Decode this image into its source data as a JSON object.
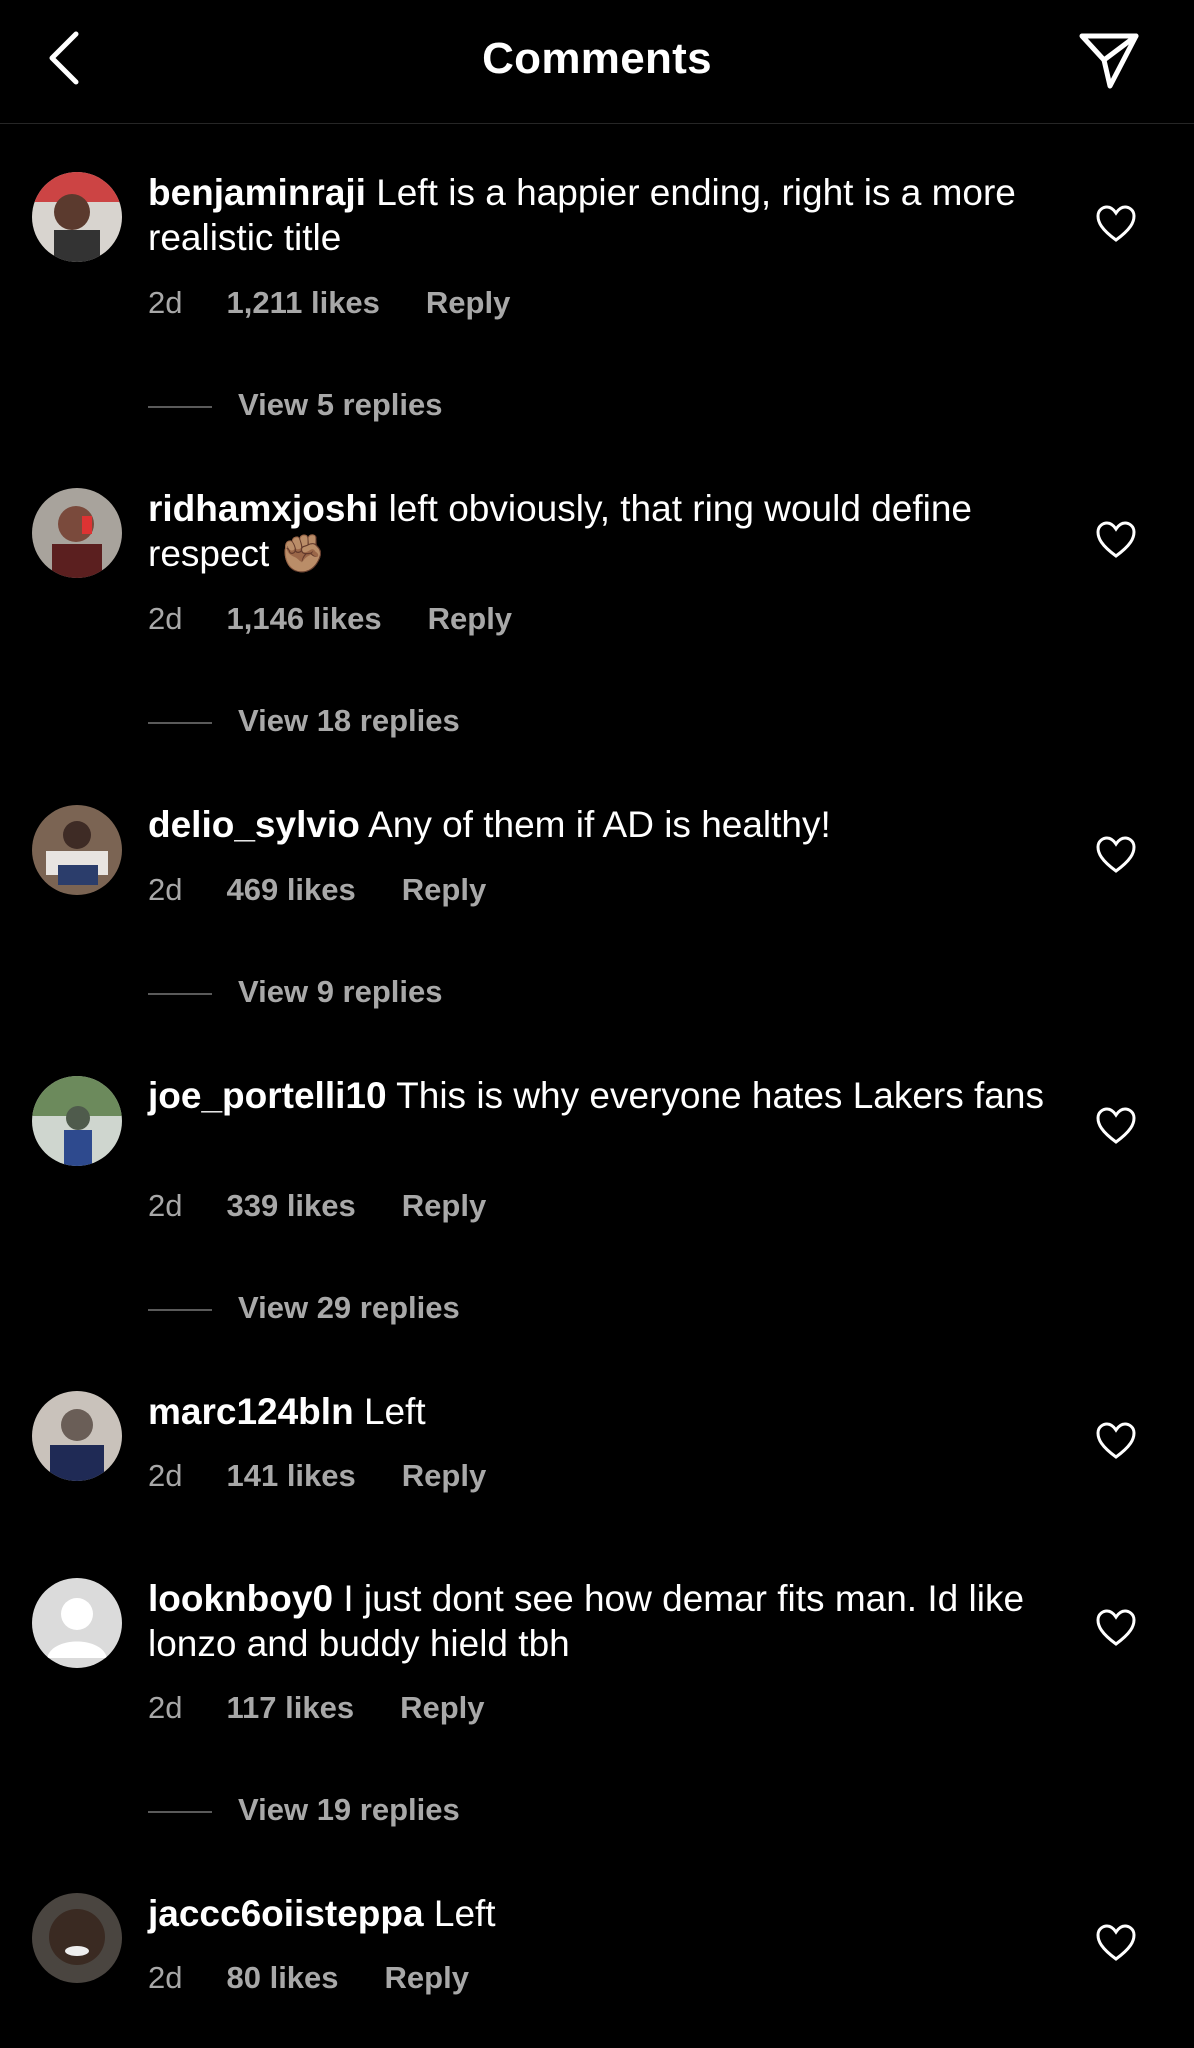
{
  "header": {
    "title": "Comments",
    "back_icon": "chevron-left-icon",
    "send_icon": "paper-plane-icon"
  },
  "comments": [
    {
      "username": "benjaminraji",
      "text": "Left is a happier ending, right is a more realistic title",
      "time": "2d",
      "likes": "1,211 likes",
      "reply": "Reply",
      "view_replies": "View 5 replies",
      "avatar_bg": "#5b3a2e"
    },
    {
      "username": "ridhamxjoshi",
      "text": "left obviously, that ring would define respect ✊🏽",
      "time": "2d",
      "likes": "1,146 likes",
      "reply": "Reply",
      "view_replies": "View 18 replies",
      "avatar_bg": "#7a4a3c"
    },
    {
      "username": "delio_sylvio",
      "text": "Any of them if AD is healthy!",
      "time": "2d",
      "likes": "469 likes",
      "reply": "Reply",
      "view_replies": "View 9 replies",
      "avatar_bg": "#3e2b25"
    },
    {
      "username": "joe_portelli10",
      "text": "This is why everyone hates Lakers fans",
      "time": "2d",
      "likes": "339 likes",
      "reply": "Reply",
      "view_replies": "View 29 replies",
      "avatar_bg": "#4f5b4c"
    },
    {
      "username": "marc124bln",
      "text": "Left",
      "time": "2d",
      "likes": "141 likes",
      "reply": "Reply",
      "view_replies": "",
      "avatar_bg": "#6a5e57"
    },
    {
      "username": "looknboy0",
      "text": "I just dont see how demar fits man. Id like lonzo and buddy hield  tbh",
      "time": "2d",
      "likes": "117 likes",
      "reply": "Reply",
      "view_replies": "View 19 replies",
      "avatar_bg": "#dbdbdb"
    },
    {
      "username": "jaccc6oiisteppa",
      "text": "Left",
      "time": "2d",
      "likes": "80 likes",
      "reply": "Reply",
      "view_replies": "",
      "avatar_bg": "#3a2a22"
    }
  ],
  "colors": {
    "background": "#000000",
    "text": "#ffffff",
    "muted": "#a8a8a8",
    "divider": "#262626"
  }
}
